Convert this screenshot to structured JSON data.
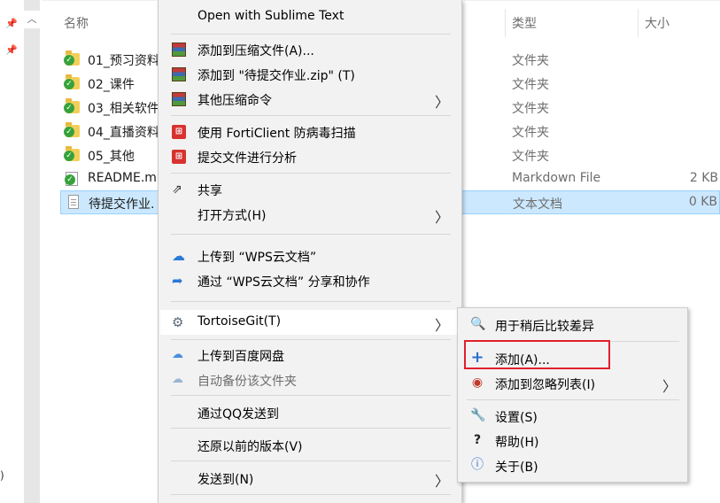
{
  "explorer": {
    "columns": {
      "name": "名称",
      "type": "类型",
      "size": "大小"
    },
    "left_edge_text": ")",
    "files": [
      {
        "name": "01_预习资料",
        "type": "文件夹",
        "size": ""
      },
      {
        "name": "02_课件",
        "type": "文件夹",
        "size": ""
      },
      {
        "name": "03_相关软件",
        "type": "文件夹",
        "size": ""
      },
      {
        "name": "04_直播资料",
        "type": "文件夹",
        "size": ""
      },
      {
        "name": "05_其他",
        "type": "文件夹",
        "size": ""
      },
      {
        "name": "README.m",
        "type": "Markdown File",
        "size": "2 KB"
      },
      {
        "name": "待提交作业.",
        "type": "文本文档",
        "size": "0 KB"
      }
    ]
  },
  "context_menu": {
    "open_sublime": "Open with Sublime Text",
    "add_archive": "添加到压缩文件(A)...",
    "add_zip": "添加到 \"待提交作业.zip\" (T)",
    "other_compress": "其他压缩命令",
    "forti_scan": "使用 FortiClient 防病毒扫描",
    "submit_analysis": "提交文件进行分析",
    "share": "共享",
    "open_with": "打开方式(H)",
    "upload_wps": "上传到 “WPS云文档”",
    "share_wps": "通过 “WPS云文档” 分享和协作",
    "tortoisegit": "TortoiseGit(T)",
    "upload_baidu": "上传到百度网盘",
    "auto_backup": "自动备份该文件夹",
    "send_qq": "通过QQ发送到",
    "restore": "还原以前的版本(V)",
    "send_to": "发送到(N)"
  },
  "submenu": {
    "diff_later": "用于稍后比较差异",
    "add": "添加(A)...",
    "add_ignore": "添加到忽略列表(I)",
    "settings": "设置(S)",
    "help": "帮助(H)",
    "about": "关于(B)"
  },
  "colors": {
    "selection": "#cce8ff",
    "highlight_box": "#e0202a",
    "menu_bg": "#f2f2f2"
  }
}
